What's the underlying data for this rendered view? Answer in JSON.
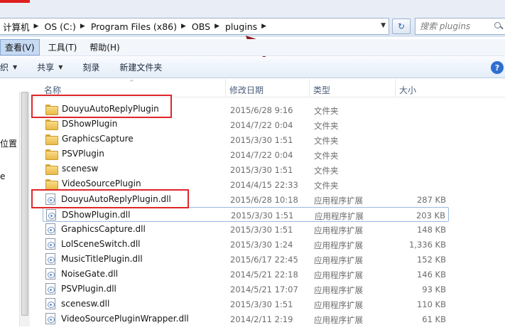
{
  "window": {
    "address_crumbs": [
      "计算机",
      "OS (C:)",
      "Program Files (x86)",
      "OBS",
      "plugins"
    ],
    "search_placeholder": "搜索 plugins",
    "accent_color": "#e01e1e"
  },
  "menubar": {
    "items": [
      "查看(V)",
      "工具(T)",
      "帮助(H)"
    ]
  },
  "toolbar": {
    "organize": "组织 ▾",
    "organize_visible": "織 ▾",
    "items": [
      "共享",
      "刻录",
      "新建文件夹"
    ]
  },
  "navpane": {
    "labels": [
      "位置",
      "e"
    ]
  },
  "columns": {
    "name": "名称",
    "date": "修改日期",
    "type": "类型",
    "size": "大小"
  },
  "files": [
    {
      "name": "DouyuAutoReplyPlugin",
      "date": "2015/6/28 9:16",
      "type": "文件夹",
      "size": "",
      "kind": "folder"
    },
    {
      "name": "DShowPlugin",
      "date": "2014/7/22 0:04",
      "type": "文件夹",
      "size": "",
      "kind": "folder"
    },
    {
      "name": "GraphicsCapture",
      "date": "2015/3/30 1:51",
      "type": "文件夹",
      "size": "",
      "kind": "folder"
    },
    {
      "name": "PSVPlugin",
      "date": "2014/7/22 0:04",
      "type": "文件夹",
      "size": "",
      "kind": "folder"
    },
    {
      "name": "scenesw",
      "date": "2015/3/30 1:51",
      "type": "文件夹",
      "size": "",
      "kind": "folder"
    },
    {
      "name": "VideoSourcePlugin",
      "date": "2014/4/15 22:33",
      "type": "文件夹",
      "size": "",
      "kind": "folder"
    },
    {
      "name": "DouyuAutoReplyPlugin.dll",
      "date": "2015/6/28 10:18",
      "type": "应用程序扩展",
      "size": "287 KB",
      "kind": "dll"
    },
    {
      "name": "DShowPlugin.dll",
      "date": "2015/3/30 1:51",
      "type": "应用程序扩展",
      "size": "203 KB",
      "kind": "dll"
    },
    {
      "name": "GraphicsCapture.dll",
      "date": "2015/3/30 1:51",
      "type": "应用程序扩展",
      "size": "148 KB",
      "kind": "dll"
    },
    {
      "name": "LolSceneSwitch.dll",
      "date": "2015/3/30 1:24",
      "type": "应用程序扩展",
      "size": "1,336 KB",
      "kind": "dll"
    },
    {
      "name": "MusicTitlePlugin.dll",
      "date": "2015/6/17 22:45",
      "type": "应用程序扩展",
      "size": "152 KB",
      "kind": "dll"
    },
    {
      "name": "NoiseGate.dll",
      "date": "2014/5/21 22:18",
      "type": "应用程序扩展",
      "size": "146 KB",
      "kind": "dll"
    },
    {
      "name": "PSVPlugin.dll",
      "date": "2014/5/21 17:07",
      "type": "应用程序扩展",
      "size": "93 KB",
      "kind": "dll"
    },
    {
      "name": "scenesw.dll",
      "date": "2015/3/30 1:51",
      "type": "应用程序扩展",
      "size": "110 KB",
      "kind": "dll"
    },
    {
      "name": "VideoSourcePluginWrapper.dll",
      "date": "2014/2/11 2:19",
      "type": "应用程序扩展",
      "size": "61 KB",
      "kind": "dll"
    }
  ],
  "highlight_color": "#e0262b"
}
